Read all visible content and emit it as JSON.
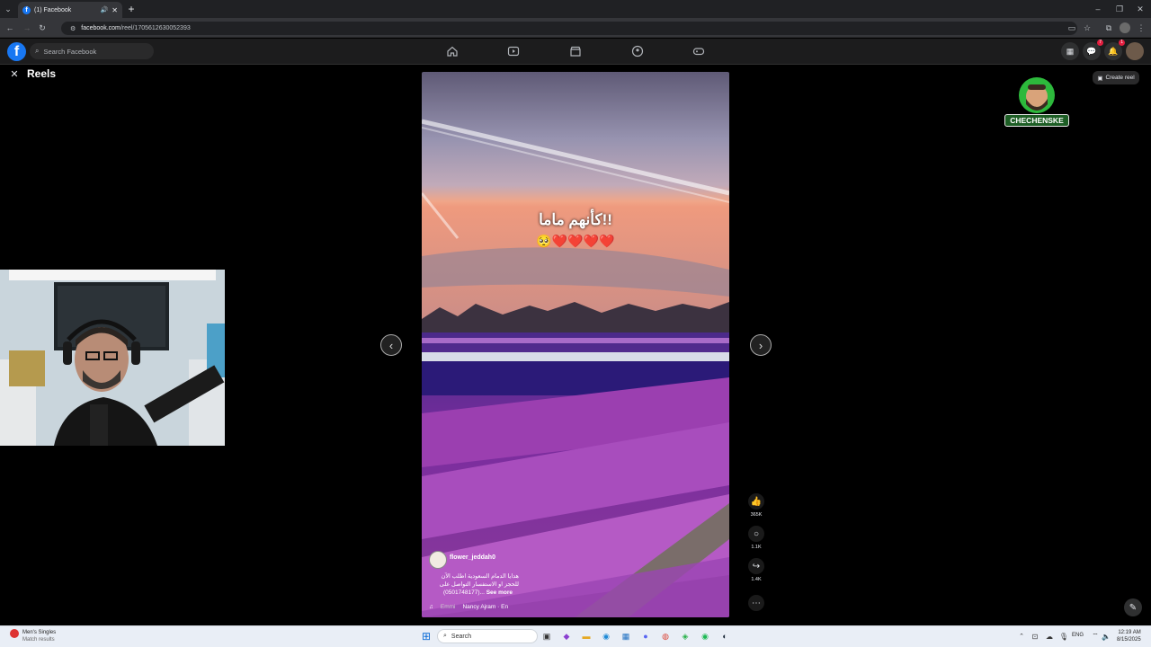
{
  "browser": {
    "tab_title": "(1) Facebook",
    "url_domain": "facebook.com",
    "url_path": "/reel/1705612630052393"
  },
  "header": {
    "logo_letter": "f",
    "search_placeholder": "Search Facebook",
    "messenger_badge": "7",
    "notifications_badge": "1"
  },
  "page": {
    "title": "Reels",
    "create_reel_label": "Create reel",
    "channel_logo_text": "CHECHENSKE"
  },
  "reel": {
    "overlay_line1": "كأنهم ماما!!",
    "overlay_emojis": "🥺❤️❤️❤️❤️",
    "author": "flower_jeddah0",
    "caption_line1": "هدايا الدمام السعودية اطلب الآن",
    "caption_line2": "للحجز او الاستفسار التواصل على",
    "caption_line3": "(0501748177)...",
    "see_more": "See more",
    "music_prefix": "Emmi",
    "music": "Nancy Ajram · En",
    "likes": "365K",
    "comments": "1.1K",
    "shares": "1.4K"
  },
  "taskbar": {
    "widget_title": "Men's Singles",
    "widget_subtitle": "Match results",
    "search_label": "Search",
    "lang": "ENG",
    "time": "12:19 AM",
    "date": "8/15/2025"
  },
  "colors": {
    "fb_blue": "#1877f2",
    "badge_red": "#e41e3f"
  }
}
